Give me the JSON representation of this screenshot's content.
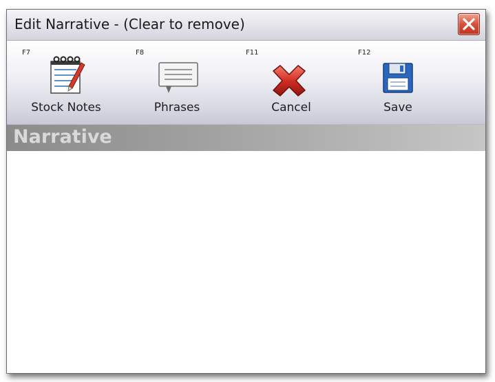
{
  "window": {
    "title": "Edit Narrative - (Clear to remove)"
  },
  "toolbar": {
    "stock_notes": {
      "key": "F7",
      "label": "Stock Notes",
      "icon": "notepad-icon"
    },
    "phrases": {
      "key": "F8",
      "label": "Phrases",
      "icon": "speech-bubble-icon"
    },
    "cancel": {
      "key": "F11",
      "label": "Cancel",
      "icon": "red-x-icon"
    },
    "save": {
      "key": "F12",
      "label": "Save",
      "icon": "floppy-disk-icon"
    }
  },
  "section": {
    "title": "Narrative"
  },
  "narrative": {
    "value": ""
  },
  "colors": {
    "close_button": "#c9402b",
    "section_header": "#a3a3a3",
    "cancel_icon": "#c8281f",
    "save_icon": "#2a68c0"
  }
}
